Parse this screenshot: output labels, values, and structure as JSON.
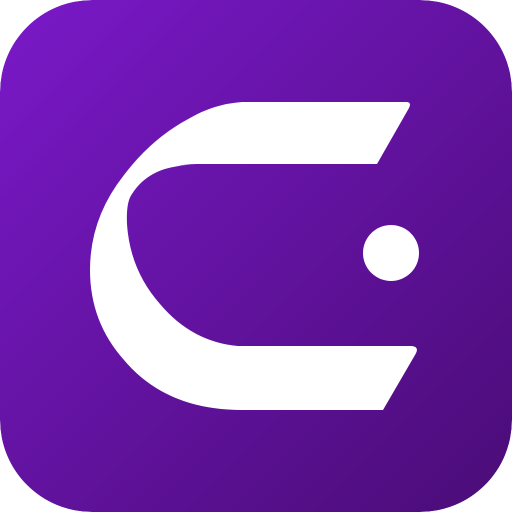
{
  "icon": {
    "name": "app-logo",
    "shape": "rounded-square",
    "glyph": "stylized-c-with-dot",
    "background": {
      "gradient_start": "#7a19c9",
      "gradient_end": "#4a0c76"
    },
    "foreground_color": "#ffffff"
  }
}
